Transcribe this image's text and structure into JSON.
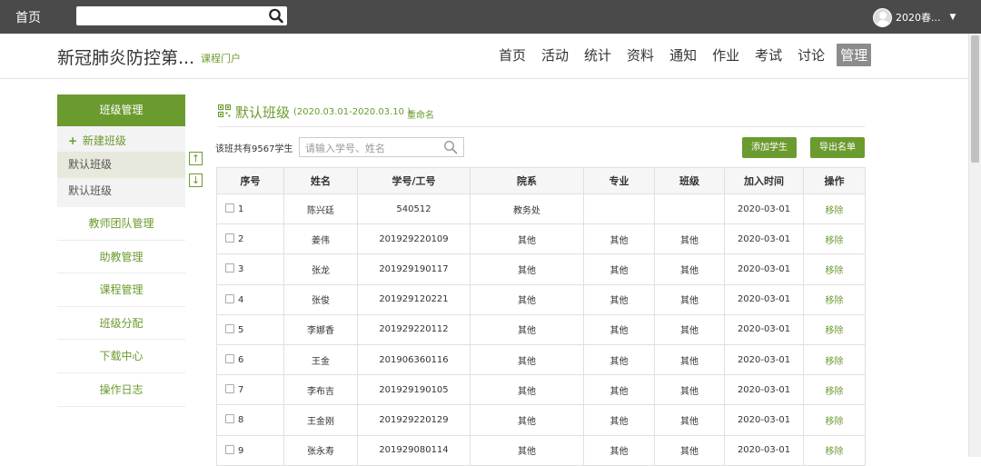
{
  "topbar": {
    "home_label": "首页",
    "search": {
      "value": "",
      "placeholder": ""
    },
    "user": {
      "name": "2020春..."
    }
  },
  "header": {
    "course_title": "新冠肺炎防控第...",
    "portal_link": "课程门户",
    "nav": [
      {
        "label": "首页",
        "active": false
      },
      {
        "label": "活动",
        "active": false
      },
      {
        "label": "统计",
        "active": false
      },
      {
        "label": "资料",
        "active": false
      },
      {
        "label": "通知",
        "active": false
      },
      {
        "label": "作业",
        "active": false
      },
      {
        "label": "考试",
        "active": false
      },
      {
        "label": "讨论",
        "active": false
      },
      {
        "label": "管理",
        "active": true
      }
    ]
  },
  "sidebar": {
    "heading": "班级管理",
    "new_class": "新建班级",
    "classes": [
      {
        "label": "默认班级",
        "selected": true
      },
      {
        "label": "默认班级",
        "selected": false
      }
    ],
    "links": [
      "教师团队管理",
      "助教管理",
      "课程管理",
      "班级分配",
      "下载中心",
      "操作日志"
    ]
  },
  "main": {
    "class_name": "默认班级",
    "class_dates": "(2020.03.01-2020.03.10 )",
    "rename_label": "重命名",
    "count_text": "该班共有9567学生",
    "search_placeholder": "请输入学号、姓名",
    "add_student_label": "添加学生",
    "export_label": "导出名单",
    "columns": [
      "序号",
      "姓名",
      "学号/工号",
      "院系",
      "专业",
      "班级",
      "加入时间",
      "操作"
    ],
    "rows": [
      {
        "no": "1",
        "name": "陈兴廷",
        "id": "540512",
        "dept": "教务处",
        "major": "",
        "cls": "",
        "date": "2020-03-01",
        "action": "移除"
      },
      {
        "no": "2",
        "name": "姜伟",
        "id": "201929220109",
        "dept": "其他",
        "major": "其他",
        "cls": "其他",
        "date": "2020-03-01",
        "action": "移除"
      },
      {
        "no": "3",
        "name": "张龙",
        "id": "201929190117",
        "dept": "其他",
        "major": "其他",
        "cls": "其他",
        "date": "2020-03-01",
        "action": "移除"
      },
      {
        "no": "4",
        "name": "张俊",
        "id": "201929120221",
        "dept": "其他",
        "major": "其他",
        "cls": "其他",
        "date": "2020-03-01",
        "action": "移除"
      },
      {
        "no": "5",
        "name": "李娜香",
        "id": "201929220112",
        "dept": "其他",
        "major": "其他",
        "cls": "其他",
        "date": "2020-03-01",
        "action": "移除"
      },
      {
        "no": "6",
        "name": "王金",
        "id": "201906360116",
        "dept": "其他",
        "major": "其他",
        "cls": "其他",
        "date": "2020-03-01",
        "action": "移除"
      },
      {
        "no": "7",
        "name": "李布吉",
        "id": "201929190105",
        "dept": "其他",
        "major": "其他",
        "cls": "其他",
        "date": "2020-03-01",
        "action": "移除"
      },
      {
        "no": "8",
        "name": "王金刚",
        "id": "201929220129",
        "dept": "其他",
        "major": "其他",
        "cls": "其他",
        "date": "2020-03-01",
        "action": "移除"
      },
      {
        "no": "9",
        "name": "张永寿",
        "id": "201929080114",
        "dept": "其他",
        "major": "其他",
        "cls": "其他",
        "date": "2020-03-01",
        "action": "移除"
      }
    ]
  },
  "colors": {
    "accent": "#6b9b2f",
    "topbar": "#4a4a4a",
    "nav_active": "#8c8c8c"
  }
}
